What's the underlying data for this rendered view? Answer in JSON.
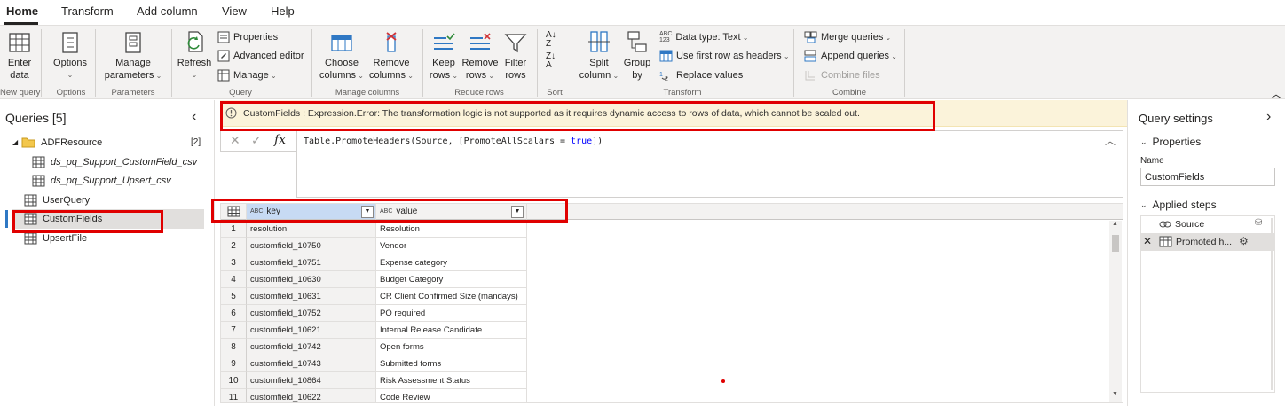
{
  "tabs": [
    {
      "label": "Home",
      "active": true
    },
    {
      "label": "Transform",
      "active": false
    },
    {
      "label": "Add column",
      "active": false
    },
    {
      "label": "View",
      "active": false
    },
    {
      "label": "Help",
      "active": false
    }
  ],
  "ribbon": {
    "enter_data": {
      "line1": "Enter",
      "line2": "data"
    },
    "options": "Options",
    "manage_parameters": {
      "line1": "Manage",
      "line2": "parameters"
    },
    "refresh": "Refresh",
    "properties": "Properties",
    "advanced_editor": "Advanced editor",
    "manage": "Manage",
    "choose_columns": {
      "line1": "Choose",
      "line2": "columns"
    },
    "remove_columns": {
      "line1": "Remove",
      "line2": "columns"
    },
    "keep_rows": {
      "line1": "Keep",
      "line2": "rows"
    },
    "remove_rows": {
      "line1": "Remove",
      "line2": "rows"
    },
    "filter_rows": {
      "line1": "Filter",
      "line2": "rows"
    },
    "split_column": {
      "line1": "Split",
      "line2": "column"
    },
    "group_by": {
      "line1": "Group",
      "line2": "by"
    },
    "data_type": "Data type: Text",
    "use_first_row": "Use first row as headers",
    "replace_values": "Replace values",
    "merge_queries": "Merge queries",
    "append_queries": "Append queries",
    "combine_files": "Combine files",
    "groups": {
      "new_query": "New query",
      "options": "Options",
      "parameters": "Parameters",
      "query": "Query",
      "manage_columns": "Manage columns",
      "reduce_rows": "Reduce rows",
      "sort": "Sort",
      "transform": "Transform",
      "combine": "Combine"
    }
  },
  "queries": {
    "title": "Queries [5]",
    "folder": {
      "name": "ADFResource",
      "count": "[2]"
    },
    "folder_items": [
      "ds_pq_Support_CustomField_csv",
      "ds_pq_Support_Upsert_csv"
    ],
    "items": [
      "UserQuery",
      "CustomFields",
      "UpsertFile"
    ]
  },
  "error": {
    "message": "CustomFields : Expression.Error: The transformation logic is not supported as it requires dynamic access to rows of data, which cannot be scaled out."
  },
  "formula": {
    "prefix": "Table.PromoteHeaders(Source, [PromoteAllScalars = ",
    "keyword": "true",
    "suffix": "])"
  },
  "grid": {
    "columns": [
      {
        "name": "key",
        "type_icon": "ABC"
      },
      {
        "name": "value",
        "type_icon": "ABC"
      }
    ],
    "rows": [
      {
        "n": "1",
        "key": "resolution",
        "value": "Resolution"
      },
      {
        "n": "2",
        "key": "customfield_10750",
        "value": "Vendor"
      },
      {
        "n": "3",
        "key": "customfield_10751",
        "value": "Expense category"
      },
      {
        "n": "4",
        "key": "customfield_10630",
        "value": "Budget Category"
      },
      {
        "n": "5",
        "key": "customfield_10631",
        "value": "CR Client Confirmed Size (mandays)"
      },
      {
        "n": "6",
        "key": "customfield_10752",
        "value": "PO required"
      },
      {
        "n": "7",
        "key": "customfield_10621",
        "value": "Internal Release Candidate"
      },
      {
        "n": "8",
        "key": "customfield_10742",
        "value": "Open forms"
      },
      {
        "n": "9",
        "key": "customfield_10743",
        "value": "Submitted forms"
      },
      {
        "n": "10",
        "key": "customfield_10864",
        "value": "Risk Assessment Status"
      },
      {
        "n": "11",
        "key": "customfield_10622",
        "value": "Code Review"
      }
    ]
  },
  "settings": {
    "title": "Query settings",
    "properties": "Properties",
    "name_label": "Name",
    "name_value": "CustomFields",
    "applied_steps": "Applied steps",
    "steps": [
      "Source",
      "Promoted h..."
    ]
  },
  "colors": {
    "highlight": "#e00000",
    "accent": "#2f78c4",
    "warning_bg": "#fbf3da"
  }
}
